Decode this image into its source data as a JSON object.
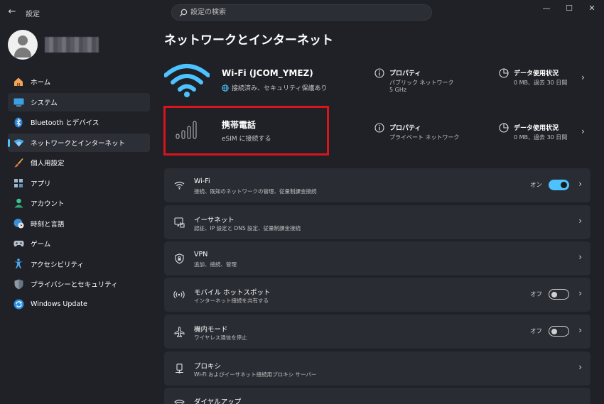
{
  "window": {
    "app_title": "設定",
    "search_placeholder": "設定の検索",
    "back_glyph": "←",
    "minimize_glyph": "—",
    "maximize_glyph": "☐",
    "close_glyph": "✕"
  },
  "colors": {
    "accent": "#4cc2ff",
    "highlight": "#d9141b",
    "background": "#1f2127",
    "card": "#2a2c33"
  },
  "sidebar": {
    "items": [
      {
        "label": "ホーム",
        "icon": "home-icon"
      },
      {
        "label": "システム",
        "icon": "system-icon"
      },
      {
        "label": "Bluetooth とデバイス",
        "icon": "bluetooth-icon"
      },
      {
        "label": "ネットワークとインターネット",
        "icon": "network-icon",
        "active": true
      },
      {
        "label": "個人用設定",
        "icon": "brush-icon"
      },
      {
        "label": "アプリ",
        "icon": "apps-icon"
      },
      {
        "label": "アカウント",
        "icon": "account-icon"
      },
      {
        "label": "時刻と言語",
        "icon": "globe-clock-icon"
      },
      {
        "label": "ゲーム",
        "icon": "gamepad-icon"
      },
      {
        "label": "アクセシビリティ",
        "icon": "accessibility-icon"
      },
      {
        "label": "プライバシーとセキュリティ",
        "icon": "shield-icon"
      },
      {
        "label": "Windows Update",
        "icon": "update-icon"
      }
    ]
  },
  "main": {
    "title": "ネットワークとインターネット",
    "wifi_conn": {
      "name": "Wi-Fi (JCOM_YMEZ)",
      "status": "接続済み、セキュリティ保護あり",
      "prop_title": "プロパティ",
      "prop_line1": "パブリック ネットワーク",
      "prop_line2": "5 GHz",
      "data_title": "データ使用状況",
      "data_sub": "0 MB、過去 30 日間"
    },
    "cell_conn": {
      "name": "携帯電話",
      "status": "eSIM に接続する",
      "prop_title": "プロパティ",
      "prop_line1": "プライベート ネットワーク",
      "data_title": "データ使用状況",
      "data_sub": "0 MB、過去 30 日間"
    },
    "cards": [
      {
        "title": "Wi-Fi",
        "sub": "接続、既知のネットワークの管理、従量制課金接続",
        "icon": "wifi-icon",
        "toggle": "on",
        "toggle_label": "オン"
      },
      {
        "title": "イーサネット",
        "sub": "認証、IP 設定と DNS 設定、従量制課金接続",
        "icon": "ethernet-icon"
      },
      {
        "title": "VPN",
        "sub": "追加、接続、管理",
        "icon": "vpn-shield-icon"
      },
      {
        "title": "モバイル ホットスポット",
        "sub": "インターネット接続を共有する",
        "icon": "hotspot-icon",
        "toggle": "off",
        "toggle_label": "オフ"
      },
      {
        "title": "機内モード",
        "sub": "ワイヤレス通信を停止",
        "icon": "airplane-icon",
        "toggle": "off",
        "toggle_label": "オフ"
      },
      {
        "title": "プロキシ",
        "sub": "Wi-Fi およびイーサネット接続用プロキシ サーバー",
        "icon": "proxy-icon"
      },
      {
        "title": "ダイヤルアップ",
        "sub": "",
        "icon": "dialup-icon"
      }
    ]
  }
}
